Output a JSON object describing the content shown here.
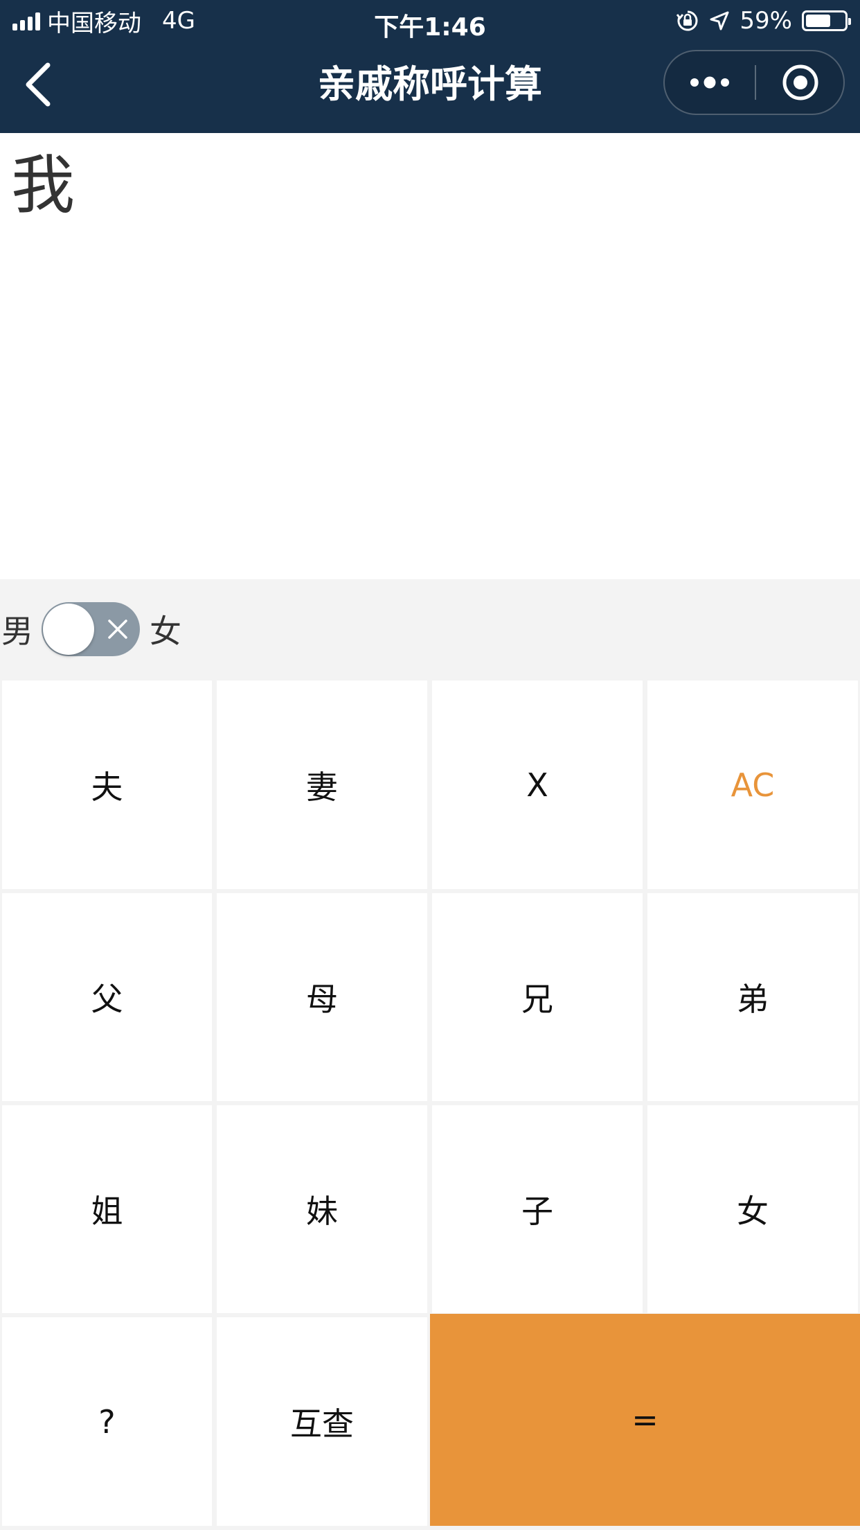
{
  "status_bar": {
    "carrier": "中国移动",
    "network": "4G",
    "time": "下午1:46",
    "battery_percent": "59%",
    "battery_level": 0.59,
    "icons": [
      "signal-icon",
      "rotation-lock-icon",
      "location-icon",
      "battery-icon"
    ]
  },
  "nav": {
    "title": "亲戚称呼计算",
    "back_icon": "back-chevron-icon",
    "more_icon": "more-dots-icon",
    "close_icon": "target-close-icon"
  },
  "display": {
    "text": "我"
  },
  "gender": {
    "male_label": "男",
    "female_label": "女",
    "toggle_on": false
  },
  "keypad": {
    "keys": {
      "husband": "夫",
      "wife": "妻",
      "backspace": "X",
      "clear": "AC",
      "father": "父",
      "mother": "母",
      "elder_brother": "兄",
      "younger_brother": "弟",
      "elder_sister": "姐",
      "younger_sister": "妹",
      "son": "子",
      "daughter": "女",
      "question": "?",
      "mutual": "互查",
      "equals": "="
    }
  },
  "colors": {
    "header_bg": "#17304a",
    "accent_orange": "#e8943a",
    "toggle_off": "#8b99a5",
    "panel_bg": "#f3f3f3"
  }
}
